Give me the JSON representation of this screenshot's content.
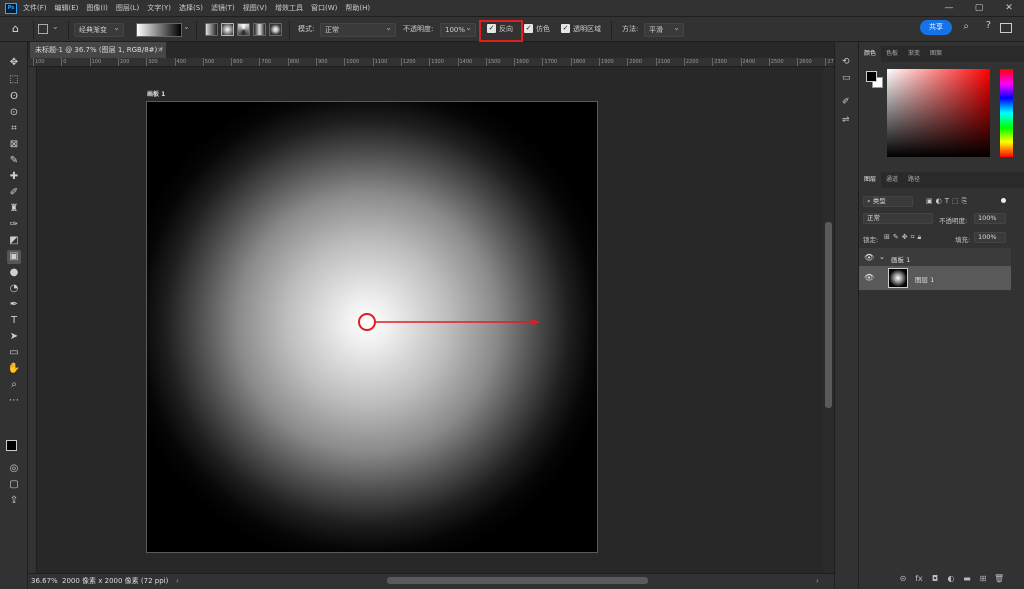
{
  "app": {
    "logo": "Ps",
    "accent": "#1473e6",
    "highlight": "#e01e1e"
  },
  "menu": [
    "文件(F)",
    "编辑(E)",
    "图像(I)",
    "图层(L)",
    "文字(Y)",
    "选择(S)",
    "滤镜(T)",
    "视图(V)",
    "增效工具",
    "窗口(W)",
    "帮助(H)"
  ],
  "window_controls": [
    "—",
    "▢",
    "✕"
  ],
  "options": {
    "gradient_preset": "经典渐变",
    "mode_label": "模式:",
    "mode_value": "正常",
    "opacity_label": "不透明度:",
    "opacity_value": "100%",
    "reverse_label": "反向",
    "dither_label": "仿色",
    "transparency_label": "透明区域",
    "method_label": "方法:",
    "method_value": "平滑",
    "share_label": "共享",
    "reverse_checked": true,
    "dither_checked": true,
    "transparency_checked": true
  },
  "document": {
    "tab_title": "未标题-1 @ 36.7% (图层 1, RGB/8#) *",
    "artboard_label": "画板 1",
    "zoom": "36.67%",
    "dimensions": "2000 像素 x 2000 像素 (72 ppi)"
  },
  "ruler_ticks": [
    "100",
    "0",
    "100",
    "200",
    "300",
    "400",
    "500",
    "600",
    "700",
    "800",
    "900",
    "1000",
    "1100",
    "1200",
    "1300",
    "1400",
    "1500",
    "1600",
    "1700",
    "1800",
    "1900",
    "2000",
    "2100",
    "2200",
    "2300",
    "2400",
    "2500",
    "2600",
    "2700",
    "2800",
    "2900"
  ],
  "color_panel": {
    "tabs": [
      "颜色",
      "色板",
      "渐变",
      "图案"
    ],
    "foreground": "#000000",
    "background": "#ffffff"
  },
  "layers_panel": {
    "tabs": [
      "图层",
      "通道",
      "路径"
    ],
    "filter_label": "类型",
    "blend_mode": "正常",
    "opacity_label": "不透明度:",
    "opacity_value": "100%",
    "lock_label": "锁定:",
    "fill_label": "填充:",
    "fill_value": "100%",
    "layers": [
      {
        "name": "画板 1",
        "type": "artboard"
      },
      {
        "name": "图层 1",
        "type": "layer",
        "selected": true
      }
    ]
  }
}
